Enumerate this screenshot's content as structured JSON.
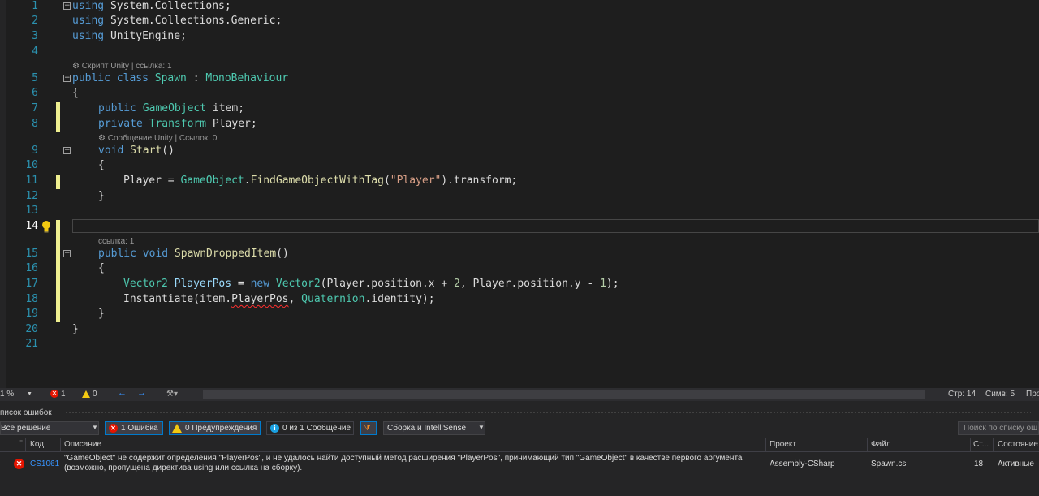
{
  "editor": {
    "line_numbers": [
      "1",
      "2",
      "3",
      "4",
      "5",
      "6",
      "7",
      "8",
      "9",
      "10",
      "11",
      "12",
      "13",
      "14",
      "15",
      "16",
      "17",
      "18",
      "19",
      "20",
      "21"
    ],
    "active_line": "14",
    "codelens": {
      "class": "Скрипт Unity | ссылка: 1",
      "start": "Сообщение Unity | Ссылок: 0",
      "spawn": "ссылка: 1"
    },
    "code": {
      "l1_kw": "using",
      "l1_rest": " System.Collections;",
      "l2_kw": "using",
      "l2_rest": " System.Collections.Generic;",
      "l3_kw": "using",
      "l3_rest": " UnityEngine;",
      "l5_kw": "public class",
      "l5_name": " Spawn",
      "l5_colon": " : ",
      "l5_base": "MonoBehaviour",
      "l6": "{",
      "l7_kw": "public",
      "l7_type": " GameObject",
      "l7_rest": " item;",
      "l8_kw": "private",
      "l8_type": " Transform",
      "l8_rest": " Player;",
      "l9_kw": "void",
      "l9_name": " Start",
      "l9_rest": "()",
      "l10": "{",
      "l11_a": "Player = ",
      "l11_type": "GameObject",
      "l11_dot": ".",
      "l11_m": "FindGameObjectWithTag",
      "l11_p1": "(",
      "l11_str": "\"Player\"",
      "l11_p2": ").transform;",
      "l12": "}",
      "l15_kw": "public void",
      "l15_name": " SpawnDroppedItem",
      "l15_rest": "()",
      "l16": "{",
      "l17_type": "Vector2",
      "l17_var": " PlayerPos",
      "l17_eq": " = ",
      "l17_new": "new",
      "l17_type2": " Vector2",
      "l17_a": "(Player.position.x + ",
      "l17_n1": "2",
      "l17_b": ", Player.position.y - ",
      "l17_n2": "1",
      "l17_c": ");",
      "l18_m": "Instantiate",
      "l18_a": "(item.",
      "l18_err": "PlayerPos",
      "l18_b": ", ",
      "l18_type": "Quaternion",
      "l18_c": ".identity);",
      "l19": "}",
      "l20": "}"
    }
  },
  "statusbar": {
    "zoom": "1 %",
    "errors": "1",
    "warnings": "0",
    "line": "Стр: 14",
    "col": "Симв: 5",
    "extra": "Про"
  },
  "error_list": {
    "title": "писок ошибок",
    "scope": "Все решение",
    "errors_btn": "1 Ошибка",
    "warnings_btn": "0 Предупреждения",
    "messages_btn": "0 из 1 Сообщение",
    "build_filter": "Сборка и IntelliSense",
    "search_placeholder": "Поиск по списку ош",
    "columns": {
      "code": "Код",
      "desc": "Описание",
      "project": "Проект",
      "file": "Файл",
      "line": "Ст...",
      "state": "Состояние"
    },
    "rows": [
      {
        "code": "CS1061",
        "desc_line1": "\"GameObject\" не содержит определения \"PlayerPos\", и не удалось найти доступный метод расширения \"PlayerPos\", принимающий тип \"GameObject\" в качестве первого аргумента",
        "desc_line2": "(возможно, пропущена директива using или ссылка на сборку).",
        "project": "Assembly-CSharp",
        "file": "Spawn.cs",
        "line": "18",
        "state": "Активные"
      }
    ]
  },
  "colors": {
    "editor_bg": "#1e1e1e",
    "keyword": "#569cd6",
    "type": "#4ec9b0",
    "method": "#dcdcaa",
    "string": "#d69d85",
    "line_number": "#2b91af",
    "error_red": "#e51400",
    "warning_yellow": "#f2c811",
    "accent": "#007acc"
  }
}
